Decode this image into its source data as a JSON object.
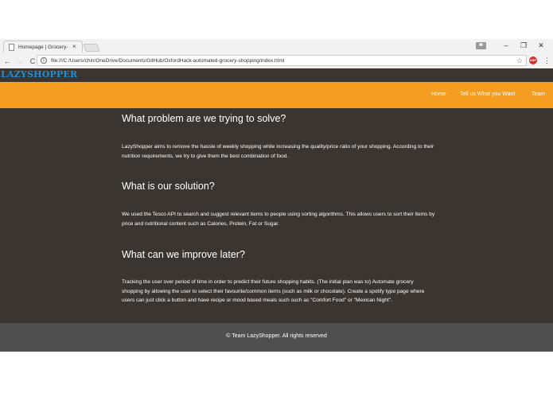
{
  "browser": {
    "tab_title": "Homepage | Grocery-sh",
    "tab_close": "×",
    "url": "file:///C:/Users/chin/OneDrive/Documents/GitHub/OxfordHack-automated-grocery-shopping/index.html",
    "info_glyph": "i",
    "back_glyph": "←",
    "forward_glyph": "→",
    "reload_glyph": "C",
    "star_glyph": "☆",
    "menu_glyph": "⋮",
    "minimize_glyph": "–",
    "restore_glyph": "❐",
    "close_glyph": "✕"
  },
  "site": {
    "brand": "LAZYSHOPPER",
    "nav": {
      "home": "Home",
      "tell": "Tell us What you Want",
      "team": "Team"
    }
  },
  "sections": [
    {
      "heading": "What problem are we trying to solve?",
      "text": "LazyShopper aims to remove the hassle of weekly shopping while increasing the quality/price ratio of your shopping. According to their nutrition requirements, we try to give them the best combination of food."
    },
    {
      "heading": "What is our solution?",
      "text": "We used the Tesco API to search and suggest relevant items to people using sorting algorithms. This allows users to sort their items by price and nutritional content such as Calories, Protein, Fat or Sugar."
    },
    {
      "heading": "What can we improve later?",
      "text": "Tracking the user over period of time in order to predict their future shopping habits. (The initial plan was to) Automate grocery shopping by allowing the user to select their favourite/common items (such as milk or chocolate). Create a spotify type page where users can just click a button and have recipe or mood based meals such such as \"Comfort Food\" or \"Mexican Night\"."
    }
  ],
  "footer": {
    "text": "© Team LazyShopper. All rights reserved"
  },
  "colors": {
    "brand": "#1e8fd8",
    "navbar": "#f59d20",
    "page_bg": "#3b3531",
    "footer_bg": "#4f4f4f"
  }
}
